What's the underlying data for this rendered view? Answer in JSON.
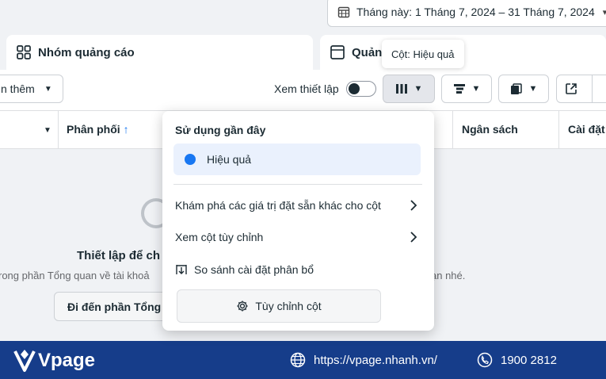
{
  "date_range": {
    "label": "Tháng này: 1 Tháng 7, 2024 – 31 Tháng 7, 2024",
    "icon": "calendar-icon"
  },
  "tabs": [
    {
      "label": "Nhóm quảng cáo",
      "icon": "grid-icon"
    },
    {
      "label": "Quản",
      "icon": "square-icon"
    }
  ],
  "tooltip": {
    "text": "Cột: Hiệu quả"
  },
  "toolbar": {
    "more_label": "n thêm",
    "view_setting_label": "Xem thiết lập",
    "toggle_on": false
  },
  "table_header": {
    "col_distribution": "Phân phối",
    "col_budget": "Ngân sách",
    "col_settings": "Cài đặt"
  },
  "empty_state": {
    "title": "Thiết lập để ch",
    "description": "rong phần Tổng quan về tài khoả",
    "description_tail": "ạn nhé.",
    "button_label": "Đi đến phần Tổng q"
  },
  "menu": {
    "heading": "Sử dụng gần đây",
    "recent_item": "Hiệu quả",
    "explore_presets": "Khám phá các giá trị đặt sẵn khác cho cột",
    "custom_columns": "Xem cột tùy chỉnh",
    "compare_allocation": "So sánh cài đặt phân bổ",
    "customize_button": "Tùy chỉnh cột"
  },
  "footer": {
    "brand": "Vpage",
    "website": "https://vpage.nhanh.vn/",
    "phone": "1900 2812"
  },
  "colors": {
    "accent": "#1877f2",
    "footer_bg": "#163d8a",
    "selected_bg": "#eaf1fd"
  }
}
